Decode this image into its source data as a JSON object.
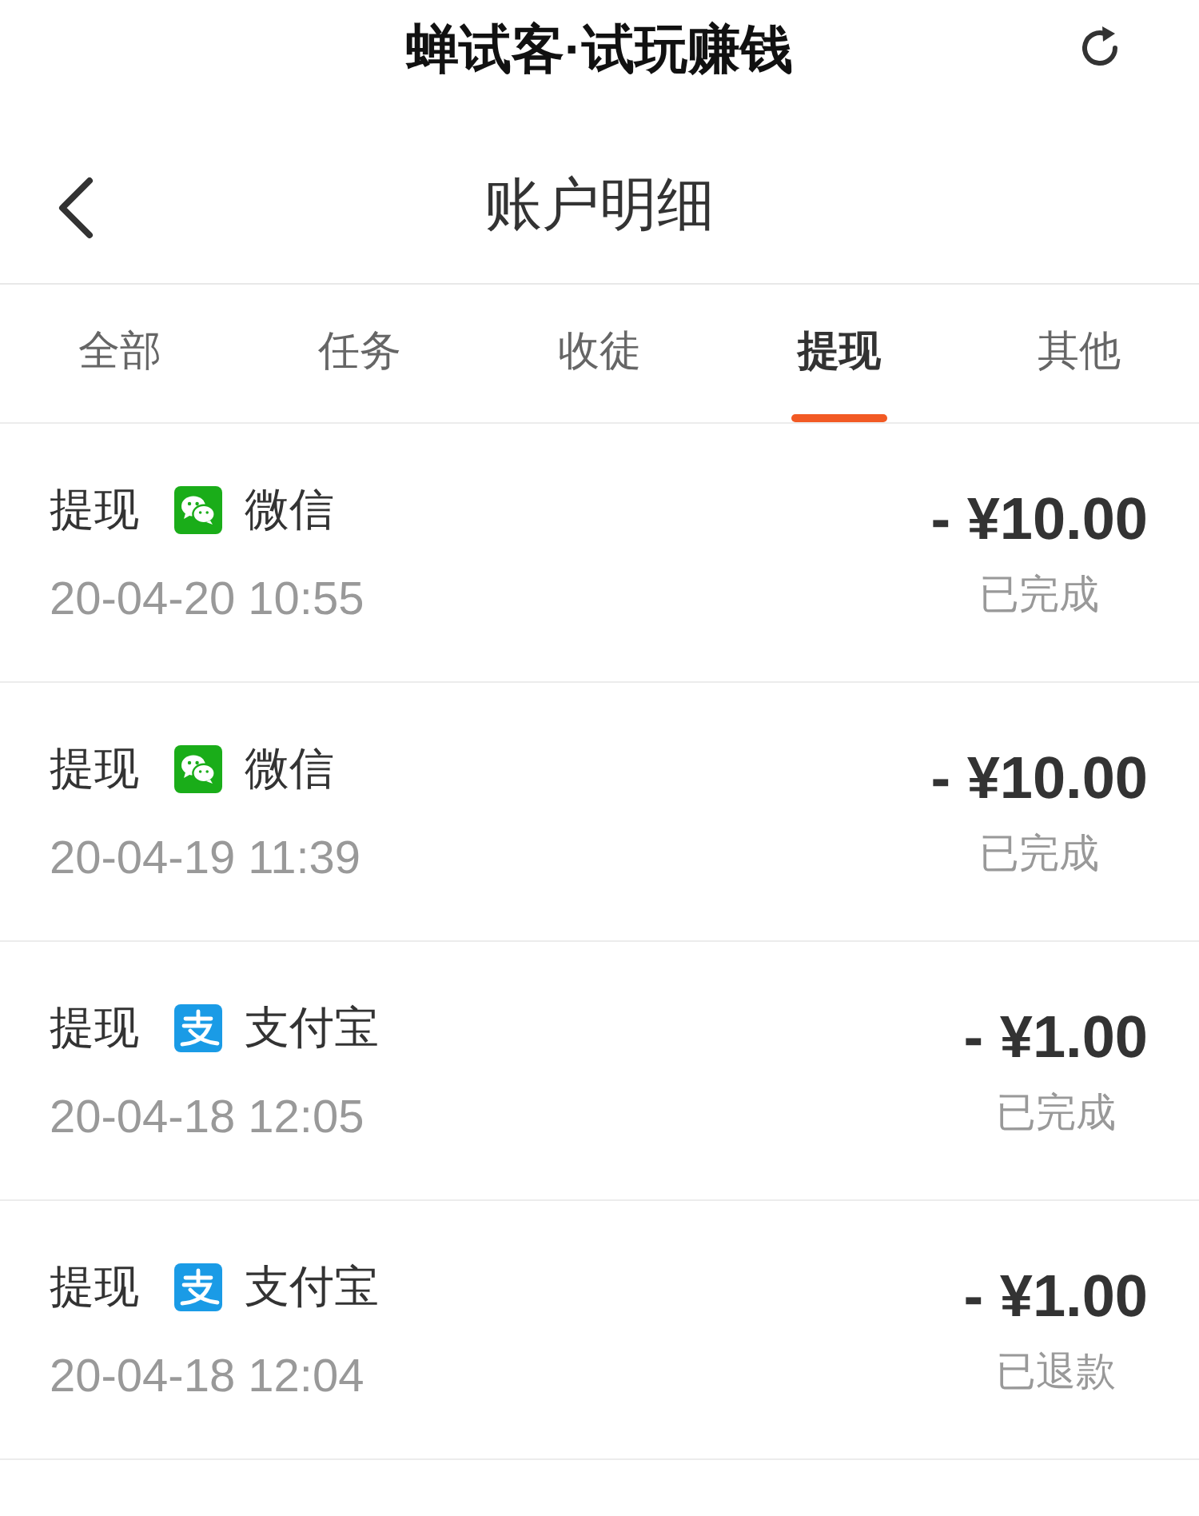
{
  "app_bar": {
    "title": "蝉试客·试玩赚钱"
  },
  "header": {
    "title": "账户明细"
  },
  "tabs": [
    {
      "label": "全部",
      "selected": false
    },
    {
      "label": "任务",
      "selected": false
    },
    {
      "label": "收徒",
      "selected": false
    },
    {
      "label": "提现",
      "selected": true
    },
    {
      "label": "其他",
      "selected": false
    }
  ],
  "records": [
    {
      "type": "提现",
      "kind": "wechat",
      "method": "微信",
      "time": "20-04-20 10:55",
      "amount": "- ¥10.00",
      "status": "已完成"
    },
    {
      "type": "提现",
      "kind": "wechat",
      "method": "微信",
      "time": "20-04-19 11:39",
      "amount": "- ¥10.00",
      "status": "已完成"
    },
    {
      "type": "提现",
      "kind": "alipay",
      "method": "支付宝",
      "time": "20-04-18 12:05",
      "amount": "- ¥1.00",
      "status": "已完成"
    },
    {
      "type": "提现",
      "kind": "alipay",
      "method": "支付宝",
      "time": "20-04-18 12:04",
      "amount": "- ¥1.00",
      "status": "已退款"
    }
  ]
}
